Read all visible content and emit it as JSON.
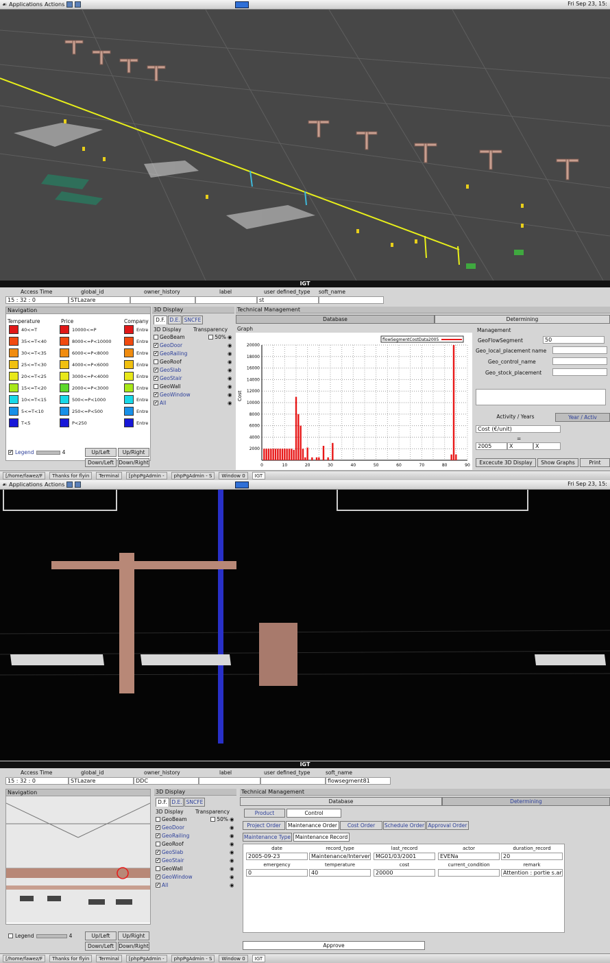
{
  "top_panel": {
    "applications": "Applications",
    "actions": "Actions",
    "clock": "Fri Sep 23, 15:"
  },
  "window_title": "IGT",
  "fields": {
    "headers": [
      "Access Time",
      "global_id",
      "owner_history",
      "label",
      "user defined_type",
      "soft_name"
    ],
    "top": {
      "access_time": "15 : 32 : 0",
      "global_id": "STLazare",
      "user_type": "st"
    },
    "bottom": {
      "access_time": "15 : 32 : 0",
      "global_id": "STLazare",
      "owner_history": "DDC",
      "soft_name": "flowsegment81"
    }
  },
  "navigation": {
    "title": "Navigation",
    "col_temp": "Temperature",
    "col_price": "Price",
    "col_company": "Company",
    "rows": [
      {
        "temp": "40<=T",
        "tcolor": "#e01818",
        "price": "10000<=P",
        "pcolor": "#e01818",
        "company": "Entre",
        "ccolor": "#e01818"
      },
      {
        "temp": "35<=T<40",
        "tcolor": "#f04a10",
        "price": "8000<=P<10000",
        "pcolor": "#f04a10",
        "company": "Entre",
        "ccolor": "#f04a10"
      },
      {
        "temp": "30<=T<35",
        "tcolor": "#f08c10",
        "price": "6000<=P<8000",
        "pcolor": "#f08c10",
        "company": "Entre",
        "ccolor": "#f08c10"
      },
      {
        "temp": "25<=T<30",
        "tcolor": "#f0c010",
        "price": "4000<=P<6000",
        "pcolor": "#f0c010",
        "company": "Entre",
        "ccolor": "#f0c010"
      },
      {
        "temp": "20<=T<25",
        "tcolor": "#e8e81a",
        "price": "3000<=P<4000",
        "pcolor": "#e8e81a",
        "company": "Entre",
        "ccolor": "#e8e81a"
      },
      {
        "temp": "15<=T<20",
        "tcolor": "#a8e81a",
        "price": "2000<=P<3000",
        "pcolor": "#5cd82a",
        "company": "Entre",
        "ccolor": "#a8e81a"
      },
      {
        "temp": "10<=T<15",
        "tcolor": "#18d8e8",
        "price": "500<=P<1000",
        "pcolor": "#18d8e8",
        "company": "Entre",
        "ccolor": "#18d8e8"
      },
      {
        "temp": "5<=T<10",
        "tcolor": "#1890e8",
        "price": "250<=P<500",
        "pcolor": "#1890e8",
        "company": "Entre",
        "ccolor": "#1890e8"
      },
      {
        "temp": "T<5",
        "tcolor": "#1818d8",
        "price": "P<250",
        "pcolor": "#1818d8",
        "company": "Entre",
        "ccolor": "#1818d8"
      }
    ],
    "legend": "Legend",
    "counter": "4",
    "up_left": "Up/Left",
    "up_right": "Up/Right",
    "down_left": "Down/Left",
    "down_right": "Down/Right"
  },
  "display3d": {
    "title": "3D Display",
    "tab1": "D.F.",
    "tab2": "D.E.",
    "tab3": "SNCFE",
    "subtitle": "3D Display",
    "transparency": "Transparency",
    "pct": "50%",
    "items": [
      {
        "label": "GeoBeam",
        "checked": "",
        "blue": false
      },
      {
        "label": "GeoDoor",
        "checked": "✔",
        "blue": true
      },
      {
        "label": "GeoRailing",
        "checked": "✔",
        "blue": true
      },
      {
        "label": "GeoRoof",
        "checked": "",
        "blue": false
      },
      {
        "label": "GeoSlab",
        "checked": "✔",
        "blue": true
      },
      {
        "label": "GeoStair",
        "checked": "✔",
        "blue": true
      },
      {
        "label": "GeoWall",
        "checked": "",
        "blue": false
      },
      {
        "label": "GeoWindow",
        "checked": "✔",
        "blue": true
      },
      {
        "label": "All",
        "checked": "✔",
        "blue": true
      }
    ]
  },
  "tech": {
    "title": "Technical Management",
    "database": "Database",
    "determining": "Determining",
    "graph": "Graph",
    "legend_name": "flowSegmentCostData2005",
    "mgmt": "Management",
    "flow_label": "GeoFlowSegment",
    "flow_value": "50",
    "rows": [
      "Geo_local_placement",
      "name",
      "Geo_control_name",
      "Geo_stock_placement"
    ],
    "activity": "Activity / Years",
    "year_activity": "Year / Activ",
    "cost": "Cost (€/unit)",
    "eq": "=",
    "year": "2005",
    "x1": "X",
    "x2": "X",
    "exec3d": "Excecute 3D Display",
    "show_graphs": "Show Graphs",
    "print": "Print"
  },
  "chart_data": {
    "type": "bar",
    "title": "",
    "xlabel": "",
    "ylabel": "Cost",
    "xlim": [
      0,
      90
    ],
    "ylim": [
      0,
      20000
    ],
    "yticks": [
      2000,
      4000,
      6000,
      8000,
      10000,
      12000,
      14000,
      16000,
      18000,
      20000
    ],
    "xticks": [
      0,
      10,
      20,
      30,
      40,
      50,
      60,
      70,
      80,
      90
    ],
    "series": [
      {
        "name": "flowSegmentCostData2005",
        "x": [
          1,
          2,
          3,
          4,
          5,
          6,
          7,
          8,
          9,
          10,
          11,
          12,
          13,
          14,
          15,
          16,
          17,
          18,
          19,
          20,
          22,
          24,
          25,
          27,
          29,
          31,
          83,
          84,
          85
        ],
        "values": [
          2000,
          2000,
          2000,
          2000,
          2000,
          2000,
          2000,
          2000,
          2000,
          2000,
          2000,
          2000,
          2000,
          1800,
          11000,
          8000,
          6000,
          2000,
          500,
          2200,
          500,
          500,
          500,
          2500,
          500,
          3000,
          1000,
          20000,
          1000
        ]
      }
    ]
  },
  "taskbar": {
    "items": [
      "[/home/fawez/F",
      "Thanks for flyin",
      "Terminal",
      "[phpPgAdmin -",
      "phpPgAdmin - S",
      "Window 0",
      "IGT"
    ]
  },
  "bottom_tech": {
    "product": "Product",
    "control": "Control",
    "tabs": [
      "Project Order",
      "Maintenance Order",
      "Cost Order",
      "Schedule Order",
      "Approval Order"
    ],
    "subtabs": [
      "Maintenance Type",
      "Maintenance Record"
    ],
    "row1_headers": [
      "date",
      "record_type",
      "last_record",
      "actor",
      "duration_record"
    ],
    "row1_values": [
      "2005-09-23",
      "Maintenance/Interventi",
      "MG01/03/2001",
      "EVENa",
      "20"
    ],
    "row2_headers": [
      "emergency",
      "temperature",
      "cost",
      "current_condition",
      "remark"
    ],
    "row2_values": [
      "0",
      "40",
      "20000",
      "",
      "Attention : portie s.arra"
    ],
    "approve": "Approve"
  }
}
